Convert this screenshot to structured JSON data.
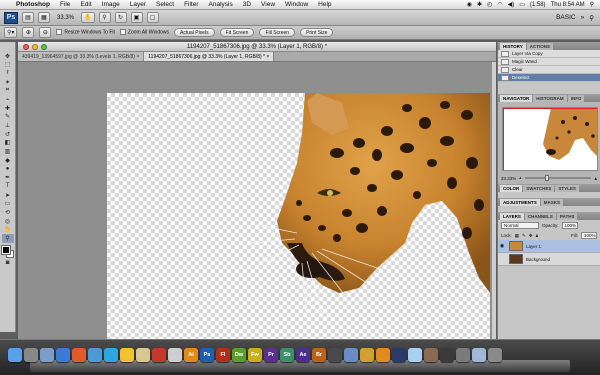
{
  "menubar": {
    "app_name": "Photoshop",
    "items": [
      "File",
      "Edit",
      "Image",
      "Layer",
      "Select",
      "Filter",
      "Analysis",
      "3D",
      "View",
      "Window",
      "Help"
    ],
    "battery": "(1:58)",
    "clock": "Thu 8:54 AM"
  },
  "appbar": {
    "logo": "Ps",
    "zoom": "33.3%",
    "workspace": "BASIC"
  },
  "options": {
    "resize_windows": "Resize Windows To Fit",
    "zoom_all": "Zoom All Windows",
    "actual_pixels": "Actual Pixels",
    "fit_screen": "Fit Screen",
    "fill_screen": "Fill Screen",
    "print_size": "Print Size"
  },
  "document": {
    "title": "1194207_51867306.jpg @ 33.3% (Layer 1, RGB/8) *",
    "tabs": [
      "439419_13964597.jpg @ 33.3% (Levels 1, RGB/8) ×",
      "1194207_51867306.jpg @ 33.3% (Layer 1, RGB/8) * ×"
    ]
  },
  "panels": {
    "history_tabs": [
      "HISTORY",
      "ACTIONS"
    ],
    "history_items": [
      "Layer Via Copy",
      "Magic Wand",
      "Clear",
      "Deselect"
    ],
    "navigator_tabs": [
      "NAVIGATOR",
      "HISTOGRAM",
      "INFO"
    ],
    "nav_zoom": "33.33%",
    "color_tabs": [
      "COLOR",
      "SWATCHES",
      "STYLES"
    ],
    "adj_tabs": [
      "ADJUSTMENTS",
      "MASKS"
    ],
    "layer_tabs": [
      "LAYERS",
      "CHANNELS",
      "PATHS"
    ],
    "blend_mode": "Normal",
    "opacity_label": "Opacity:",
    "opacity": "100%",
    "lock_label": "Lock:",
    "fill_label": "Fill:",
    "fill": "100%",
    "layers": [
      "Layer 1",
      "Background"
    ]
  },
  "dock": {
    "icons": [
      {
        "label": "",
        "color": "#5aa0e8"
      },
      {
        "label": "",
        "color": "#888888"
      },
      {
        "label": "",
        "color": "#7d9cc8"
      },
      {
        "label": "",
        "color": "#3a7bd5"
      },
      {
        "label": "",
        "color": "#e05a2a"
      },
      {
        "label": "",
        "color": "#4e9ad8"
      },
      {
        "label": "",
        "color": "#2ea7e0"
      },
      {
        "label": "",
        "color": "#f2c230"
      },
      {
        "label": "",
        "color": "#d8c890"
      },
      {
        "label": "",
        "color": "#c43a2a"
      },
      {
        "label": "",
        "color": "#cfcfcf"
      },
      {
        "label": "Ai",
        "color": "#e08a1a"
      },
      {
        "label": "Ps",
        "color": "#1d5fb0"
      },
      {
        "label": "Fl",
        "color": "#b0301c"
      },
      {
        "label": "Dw",
        "color": "#5d9e2a"
      },
      {
        "label": "Fw",
        "color": "#c7b020"
      },
      {
        "label": "Pr",
        "color": "#5a2f8f"
      },
      {
        "label": "Sb",
        "color": "#3a8f6a"
      },
      {
        "label": "Ae",
        "color": "#4b2f8f"
      },
      {
        "label": "Br",
        "color": "#b8631c"
      },
      {
        "label": "",
        "color": "#4a4a4a"
      },
      {
        "label": "",
        "color": "#6a8cc8"
      },
      {
        "label": "",
        "color": "#d2a030"
      },
      {
        "label": "",
        "color": "#e08a20"
      },
      {
        "label": "",
        "color": "#2a3a6a"
      },
      {
        "label": "",
        "color": "#a8d0f0"
      },
      {
        "label": "",
        "color": "#8a6a50"
      },
      {
        "label": "",
        "color": "#3a3a3a"
      },
      {
        "label": "",
        "color": "#7a7a7a"
      },
      {
        "label": "",
        "color": "#9fb8d8"
      },
      {
        "label": "",
        "color": "#8a8a8a"
      }
    ]
  }
}
